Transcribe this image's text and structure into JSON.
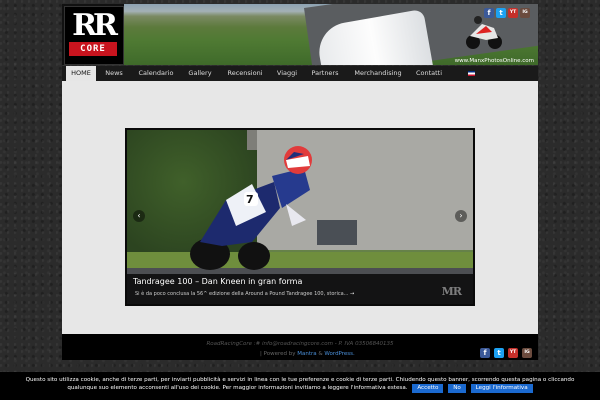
{
  "header": {
    "logo_letters": "RR",
    "logo_word": "CORE",
    "banner_credit": "www.ManxPhotosOnline.com",
    "social": [
      "f",
      "t",
      "YT",
      "IG"
    ]
  },
  "nav": {
    "items": [
      "HOME",
      "News",
      "Calendario",
      "Gallery",
      "Recensioni",
      "Viaggi",
      "Partners",
      "Merchandising",
      "Contatti"
    ],
    "active": "HOME"
  },
  "slide": {
    "title": "Tandragee 100 – Dan Kneen in gran forma",
    "excerpt": "Si è da poco conclusa la 56^ edizione della Around a Pound Tandragee 100, storica...",
    "more": "→",
    "rider_number": "7",
    "watermark": "MR",
    "prev": "‹",
    "next": "›"
  },
  "footer": {
    "line1": "RoadRacingCore :# info@roadracingcore.com - P. IVA 03506840135",
    "powered_prefix": "| Powered by",
    "mantra": "Mantra",
    "amp": "&",
    "wordpress": "WordPress."
  },
  "cookie": {
    "text": "Questo sito utilizza cookie, anche di terze parti, per inviarti pubblicità e servizi in linea con le tue preferenze e cookie di terze parti. Chiudendo questo banner, scorrendo questa pagina o cliccando qualunque suo elemento acconsenti all'uso dei cookie. Per maggior informazioni invitiamo a leggere l'informativa estesa.",
    "accept": "Accetto",
    "no": "No",
    "info": "Leggi l'informativa"
  },
  "colors": {
    "accent_red": "#c8141e",
    "link_blue": "#1b6ad0",
    "facebook": "#3b5998",
    "twitter": "#1da1f2",
    "youtube": "#c4302b",
    "instagram": "#6b4b3e"
  }
}
